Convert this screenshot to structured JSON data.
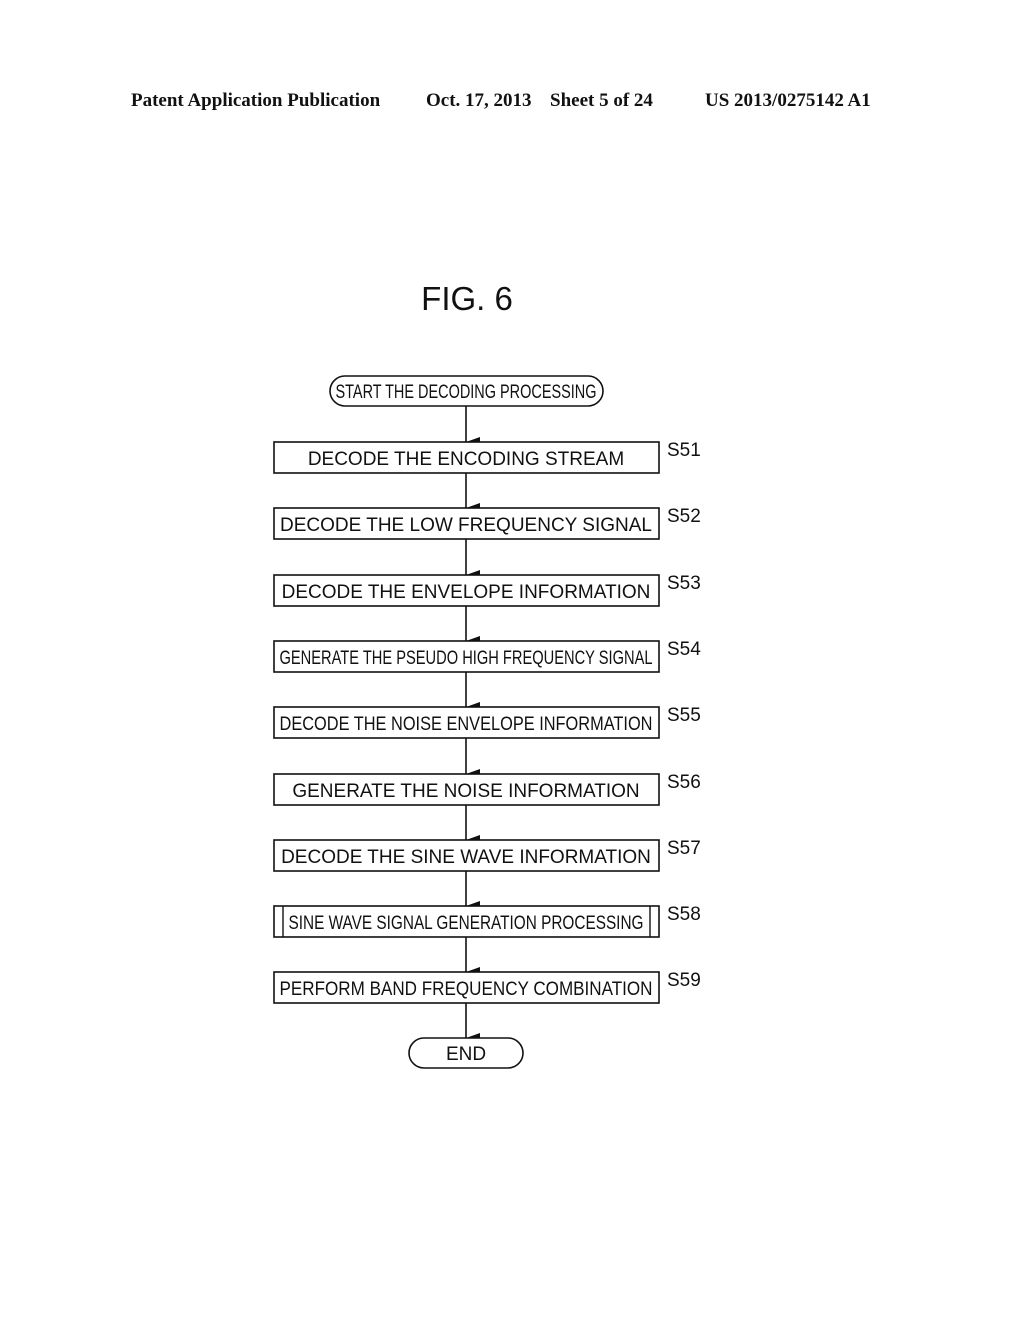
{
  "header": {
    "publication": "Patent Application Publication",
    "date": "Oct. 17, 2013",
    "sheet": "Sheet 5 of 24",
    "number": "US 2013/0275142 A1"
  },
  "figure": {
    "title": "FIG. 6",
    "start": "START THE DECODING PROCESSING",
    "end": "END",
    "steps": [
      {
        "id": "S51",
        "text": "DECODE THE ENCODING STREAM",
        "type": "process"
      },
      {
        "id": "S52",
        "text": "DECODE THE LOW FREQUENCY SIGNAL",
        "type": "process"
      },
      {
        "id": "S53",
        "text": "DECODE THE ENVELOPE INFORMATION",
        "type": "process"
      },
      {
        "id": "S54",
        "text": "GENERATE THE PSEUDO HIGH FREQUENCY SIGNAL",
        "type": "process"
      },
      {
        "id": "S55",
        "text": "DECODE THE NOISE ENVELOPE INFORMATION",
        "type": "process"
      },
      {
        "id": "S56",
        "text": "GENERATE THE NOISE INFORMATION",
        "type": "process"
      },
      {
        "id": "S57",
        "text": "DECODE THE SINE WAVE INFORMATION",
        "type": "process"
      },
      {
        "id": "S58",
        "text": "SINE WAVE SIGNAL GENERATION PROCESSING",
        "type": "subroutine"
      },
      {
        "id": "S59",
        "text": "PERFORM BAND FREQUENCY COMBINATION",
        "type": "process"
      }
    ]
  }
}
